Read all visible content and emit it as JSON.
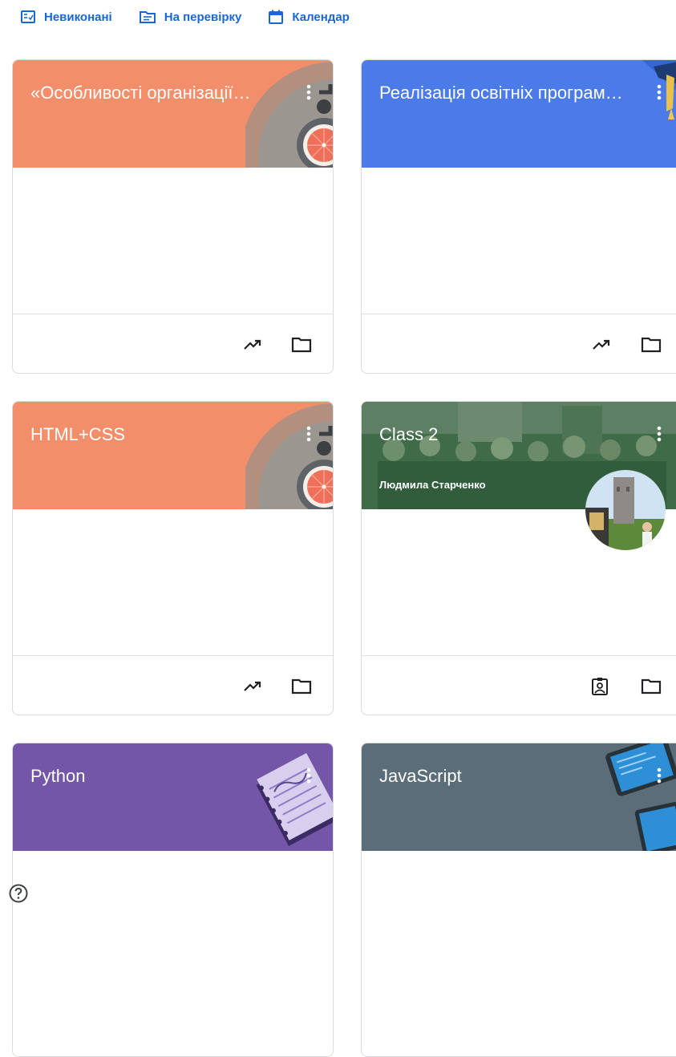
{
  "nav": {
    "todo_label": "Невиконані",
    "review_label": "На перевірку",
    "calendar_label": "Календар"
  },
  "cards": [
    {
      "title": "«Особливості організації…",
      "color": "#f28f6a",
      "illustration": "robot-head-illustration",
      "footer_icons": [
        "trending-up-icon",
        "folder-icon"
      ]
    },
    {
      "title": "Реалізація освітніх програм…",
      "color": "#4a7be8",
      "illustration": "graduation-cap-illustration",
      "footer_icons": [
        "trending-up-icon",
        "folder-icon"
      ]
    },
    {
      "title": "HTML+CSS",
      "color": "#f28f6a",
      "illustration": "robot-head-illustration",
      "footer_icons": [
        "trending-up-icon",
        "folder-icon"
      ]
    },
    {
      "title": "Class 2",
      "subtitle": "Людмила Старченко",
      "color": "#3d6b47",
      "illustration": "class-photo",
      "avatar": "teacher-avatar",
      "footer_icons": [
        "assignment-ind-icon",
        "folder-icon"
      ]
    },
    {
      "title": "Python",
      "color": "#7356a8",
      "illustration": "notebook-illustration"
    },
    {
      "title": "JavaScript",
      "color": "#5b6d78",
      "illustration": "tablet-illustration"
    }
  ],
  "colors": {
    "link": "#1967d2",
    "divider": "#dadce0"
  },
  "help_icon": "help-circle-icon"
}
